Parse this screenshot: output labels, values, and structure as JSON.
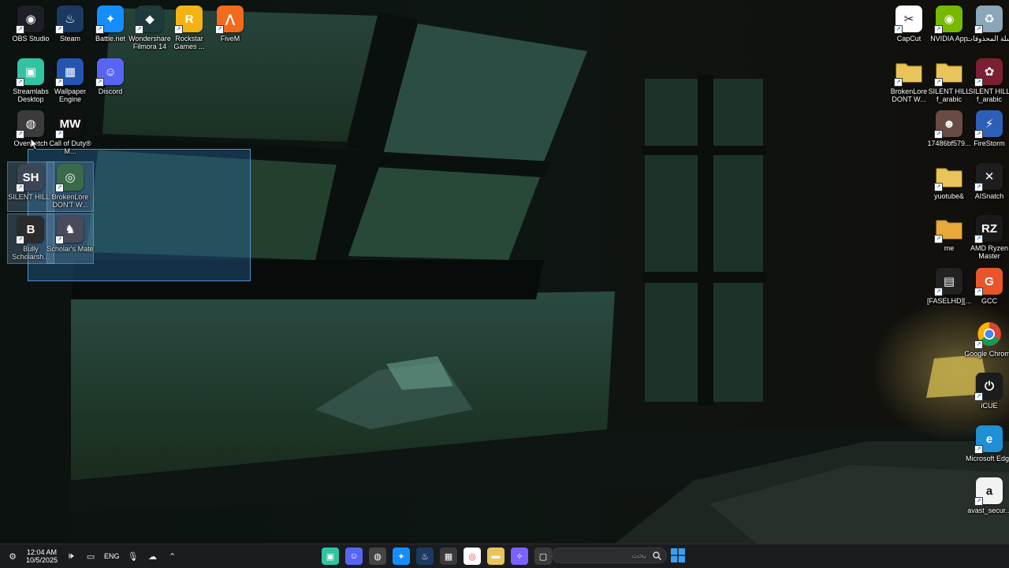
{
  "desktop": {
    "left_icons": [
      {
        "name": "obs-studio",
        "label": "OBS Studio",
        "icon": "obs-icon",
        "color": "#1e1f26",
        "glyph": "◉"
      },
      {
        "name": "steam",
        "label": "Steam",
        "icon": "steam-icon",
        "color": "#1b3a63",
        "glyph": "♨"
      },
      {
        "name": "battle-net",
        "label": "Battle.net",
        "icon": "battle-net-icon",
        "color": "#148eff",
        "glyph": "✦"
      },
      {
        "name": "wondershare-filmora",
        "label": "Wondershare Filmora 14",
        "icon": "filmora-icon",
        "color": "#1f3a3a",
        "glyph": "◆"
      },
      {
        "name": "rockstar-games",
        "label": "Rockstar Games ...",
        "icon": "rockstar-icon",
        "color": "#f4b312",
        "glyph": "R"
      },
      {
        "name": "fivem",
        "label": "FiveM",
        "icon": "fivem-icon",
        "color": "#f26b1d",
        "glyph": "⋀"
      },
      {
        "name": "streamlabs",
        "label": "Streamlabs Desktop",
        "icon": "streamlabs-icon",
        "color": "#31c3a2",
        "glyph": "▣"
      },
      {
        "name": "wallpaper-engine",
        "label": "Wallpaper Engine",
        "icon": "wallpaper-engine-icon",
        "color": "#2455b0",
        "glyph": "▦"
      },
      {
        "name": "discord",
        "label": "Discord",
        "icon": "discord-icon",
        "color": "#5865f2",
        "glyph": "☺"
      },
      {
        "name": "overwatch",
        "label": "Overwatch",
        "icon": "overwatch-icon",
        "color": "#3b3b3b",
        "glyph": "◍"
      },
      {
        "name": "call-of-duty",
        "label": "Call of Duty® M...",
        "icon": "call-of-duty-icon",
        "color": "#111111",
        "glyph": "MW"
      },
      {
        "name": "silent-hill-f",
        "label": "SILENT HILL f",
        "icon": "silent-hill-icon",
        "color": "#3d4654",
        "glyph": "SH"
      },
      {
        "name": "brokenlore",
        "label": "BrokenLore DON'T W...",
        "icon": "brokenlore-icon",
        "color": "#3a6a4a",
        "glyph": "◎"
      },
      {
        "name": "bully",
        "label": "Bully Scholarsh...",
        "icon": "bully-icon",
        "color": "#2b2b2b",
        "glyph": "B"
      },
      {
        "name": "scholars-mate",
        "label": "Scholar's Mate",
        "icon": "scholars-mate-icon",
        "color": "#4a4a5a",
        "glyph": "♞"
      }
    ],
    "right_icons": [
      {
        "name": "capcut",
        "label": "CapCut",
        "icon": "capcut-icon",
        "color": "#ffffff",
        "glyph": "✂",
        "dark": true
      },
      {
        "name": "nvidia-app",
        "label": "NVIDIA App",
        "icon": "nvidia-icon",
        "color": "#76b900",
        "glyph": "◉"
      },
      {
        "name": "recycle-bin",
        "label": "سلة المحذوفات",
        "icon": "recycle-bin-icon",
        "color": "#8aa6b8",
        "glyph": "♻"
      },
      {
        "name": "brokenlore-folder",
        "label": "BrokenLore DONT W...",
        "icon": "folder-icon",
        "color": "#e8c45a",
        "glyph": ""
      },
      {
        "name": "silent-hill-folder",
        "label": "SILENT HILL f_arabic",
        "icon": "folder-icon",
        "color": "#e8c45a",
        "glyph": ""
      },
      {
        "name": "silent-hill-arabic",
        "label": "SILENT HILL f_arabic",
        "icon": "silent-hill-app-icon",
        "color": "#7a2030",
        "glyph": "✿"
      },
      {
        "name": "image-file",
        "label": "17486bf579...",
        "icon": "image-file-icon",
        "color": "#6a4a44",
        "glyph": "☻"
      },
      {
        "name": "firestorm",
        "label": "FireStorm",
        "icon": "firestorm-icon",
        "color": "#2e5fb8",
        "glyph": "⚡"
      },
      {
        "name": "yuotube-folder",
        "label": "yuotube&",
        "icon": "folder-icon",
        "color": "#e8c45a",
        "glyph": ""
      },
      {
        "name": "aisnatch",
        "label": "AISnatch",
        "icon": "aisnatch-icon",
        "color": "#1e1e1e",
        "glyph": "✕"
      },
      {
        "name": "me-folder",
        "label": "me",
        "icon": "folder-icon",
        "color": "#e8a83a",
        "glyph": ""
      },
      {
        "name": "amd-ryzen-master",
        "label": "AMD Ryzen Master",
        "icon": "amd-ryzen-icon",
        "color": "#1a1a1a",
        "glyph": "RZ"
      },
      {
        "name": "faselhd",
        "label": "[FASELHD][...",
        "icon": "video-file-icon",
        "color": "#222222",
        "glyph": "▤"
      },
      {
        "name": "gcc",
        "label": "GCC",
        "icon": "gcc-icon",
        "color": "#e8552a",
        "glyph": "G"
      },
      {
        "name": "google-chrome",
        "label": "Google Chrome",
        "icon": "chrome-icon",
        "color": "#ffffff",
        "glyph": "◎",
        "chrome": true
      },
      {
        "name": "icue",
        "label": "iCUE",
        "icon": "icue-icon",
        "color": "#1c1c1c",
        "glyph": "⏻"
      },
      {
        "name": "microsoft-edge",
        "label": "Microsoft Edge",
        "icon": "edge-icon",
        "color": "#1f8fd6",
        "glyph": "e"
      },
      {
        "name": "avast",
        "label": "avast_secur...",
        "icon": "avast-icon",
        "color": "#f2f2f2",
        "glyph": "a",
        "dark": true
      }
    ]
  },
  "taskbar": {
    "clock_time": "12:04 AM",
    "clock_date": "10/5/2025",
    "language": "ENG",
    "search_placeholder": "بحث",
    "tray_icons": [
      "settings-icon",
      "volume-icon",
      "display-icon",
      "microphone-icon",
      "onedrive-icon",
      "chevron-up-icon"
    ],
    "pinned_apps": [
      {
        "name": "streamlabs",
        "icon": "streamlabs-icon",
        "color": "#31c3a2",
        "glyph": "▣"
      },
      {
        "name": "discord",
        "icon": "discord-icon",
        "color": "#5865f2",
        "glyph": "☺"
      },
      {
        "name": "overwatch",
        "icon": "overwatch-icon",
        "color": "#444",
        "glyph": "◍"
      },
      {
        "name": "battle-net",
        "icon": "battle-net-icon",
        "color": "#148eff",
        "glyph": "✦"
      },
      {
        "name": "steam",
        "icon": "steam-icon",
        "color": "#1b3a63",
        "glyph": "♨"
      },
      {
        "name": "microsoft-store",
        "icon": "store-icon",
        "color": "#3a3a3a",
        "glyph": "▦"
      },
      {
        "name": "google-chrome",
        "icon": "chrome-icon",
        "color": "#ffffff",
        "glyph": "◎"
      },
      {
        "name": "file-explorer",
        "icon": "folder-icon",
        "color": "#e8c45a",
        "glyph": "▬"
      },
      {
        "name": "copilot",
        "icon": "copilot-icon",
        "color": "#7b61ff",
        "glyph": "✧"
      },
      {
        "name": "task-view",
        "icon": "task-view-icon",
        "color": "#3a3a3a",
        "glyph": "▢"
      }
    ]
  }
}
